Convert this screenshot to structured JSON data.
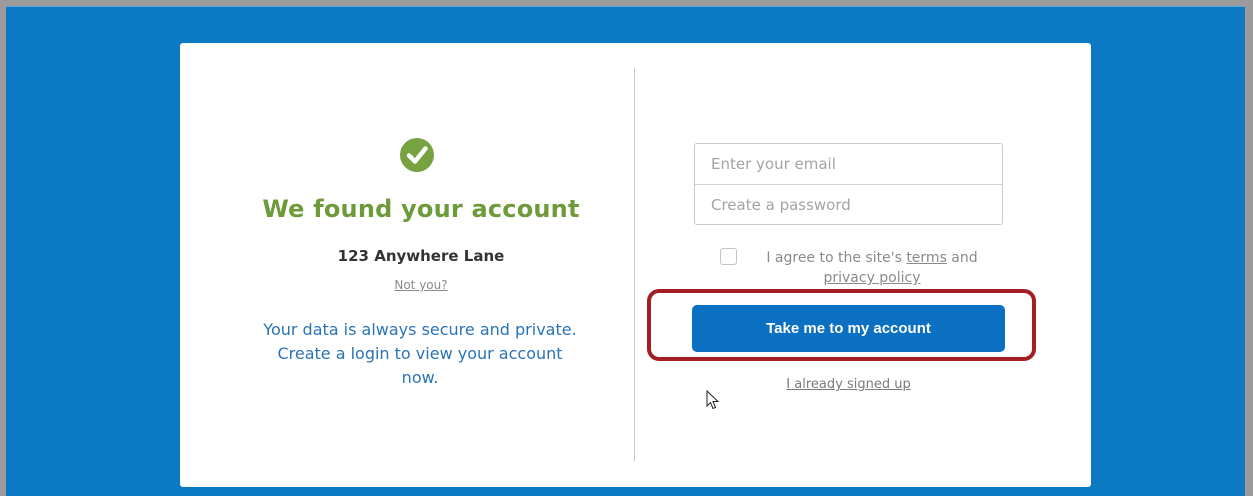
{
  "account": {
    "title": "We found your account",
    "address": "123 Anywhere Lane",
    "not_you": "Not you?",
    "secure_line1": "Your data is always secure and private.",
    "secure_line2": "Create a login to view your account",
    "secure_line3": "now."
  },
  "form": {
    "email_placeholder": "Enter your email",
    "password_placeholder": "Create a password",
    "agree_prefix": "I agree to the site's ",
    "terms_link": "terms",
    "agree_and": " and",
    "privacy_link": "privacy policy",
    "submit_label": "Take me to my account",
    "already_signed_up": "I already signed up"
  },
  "colors": {
    "page_background": "#0b79c3",
    "success_green": "#76a23f",
    "primary_button": "#0b6fc2",
    "highlight_border": "#a31f25"
  },
  "icons": {
    "success": "checkmark-circle-icon",
    "pointer": "mouse-cursor-icon"
  }
}
